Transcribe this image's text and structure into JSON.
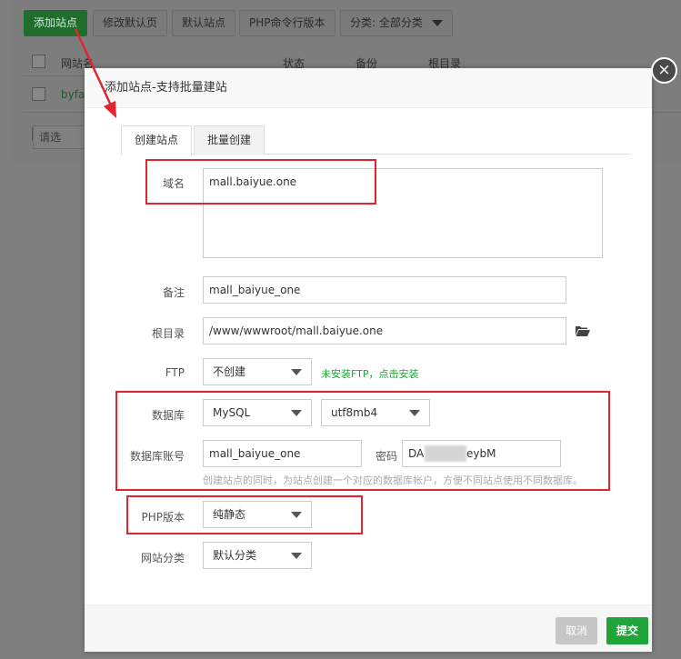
{
  "background": {
    "toolbar": {
      "add_site": "添加站点",
      "edit_default_page": "修改默认页",
      "default_site": "默认站点",
      "php_cli_version": "PHP命令行版本",
      "category_filter": "分类: 全部分类"
    },
    "table": {
      "col_site": "网站名",
      "col_status": "状态",
      "col_backup": "备份",
      "col_root": "根目录",
      "row_site": "byfa",
      "select_placeholder": "请选"
    }
  },
  "modal": {
    "title": "添加站点-支持批量建站",
    "tabs": [
      "创建站点",
      "批量创建"
    ],
    "close_symbol": "×",
    "fields": {
      "domain_label": "域名",
      "domain_value": "mall.baiyue.one",
      "remark_label": "备注",
      "remark_value": "mall_baiyue_one",
      "root_label": "根目录",
      "root_value": "/www/wwwroot/mall.baiyue.one",
      "ftp_label": "FTP",
      "ftp_value": "不创建",
      "ftp_link": "未安装FTP，点击安装",
      "db_label": "数据库",
      "db_type": "MySQL",
      "db_charset": "utf8mb4",
      "db_account_label": "数据库账号",
      "db_account_value": "mall_baiyue_one",
      "db_password_label": "密码",
      "db_password_start": "DA",
      "db_password_end": "eybM",
      "db_hint": "创建站点的同时，为站点创建一个对应的数据库帐户，方便不同站点使用不同数据库。",
      "php_label": "PHP版本",
      "php_value": "纯静态",
      "category_label": "网站分类",
      "category_value": "默认分类"
    },
    "buttons": {
      "cancel": "取消",
      "submit": "提交"
    }
  },
  "colors": {
    "accent_green": "#20a53a",
    "annotation_red": "#e0252f"
  }
}
